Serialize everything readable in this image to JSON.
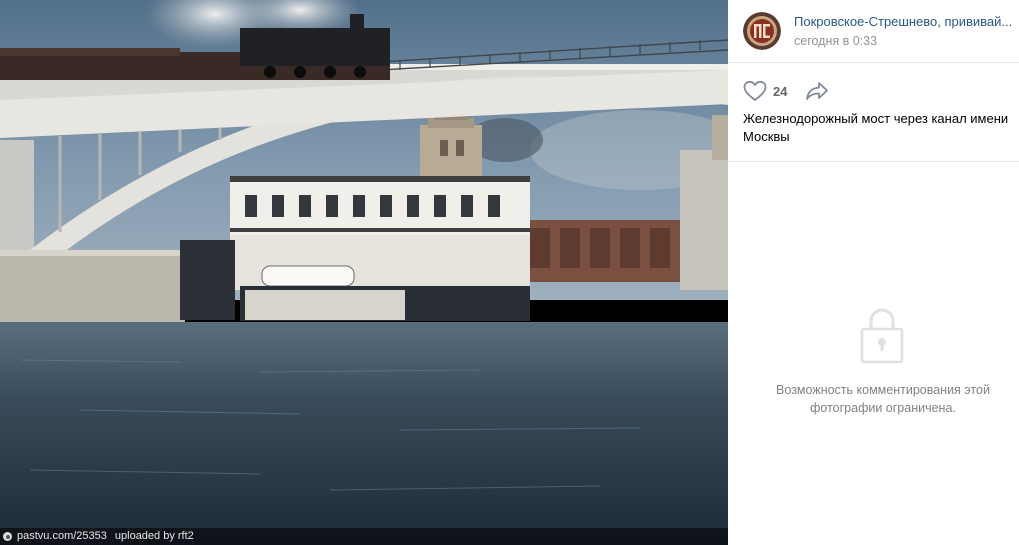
{
  "viewer": {
    "watermark": {
      "source": "pastvu.com/25353",
      "uploader": "uploaded by rft2"
    }
  },
  "post": {
    "author_name": "Покровское-Стрешнево, прививай...",
    "timestamp": "сегодня в 0:33",
    "likes": "24",
    "caption": "Железнодорожный мост через канал имени Москвы"
  },
  "comments": {
    "notice": "Возможность комментирования этой фотографии ограничена."
  },
  "icons": {
    "like": "heart-outline-icon",
    "share": "share-arrow-icon",
    "lock": "padlock-icon",
    "watermark": "pastvu-logo-icon"
  },
  "colors": {
    "link": "#2a5885",
    "muted": "#939393",
    "icon": "#828a99",
    "divider": "#e7e8ec",
    "lock": "#dce1e6"
  }
}
